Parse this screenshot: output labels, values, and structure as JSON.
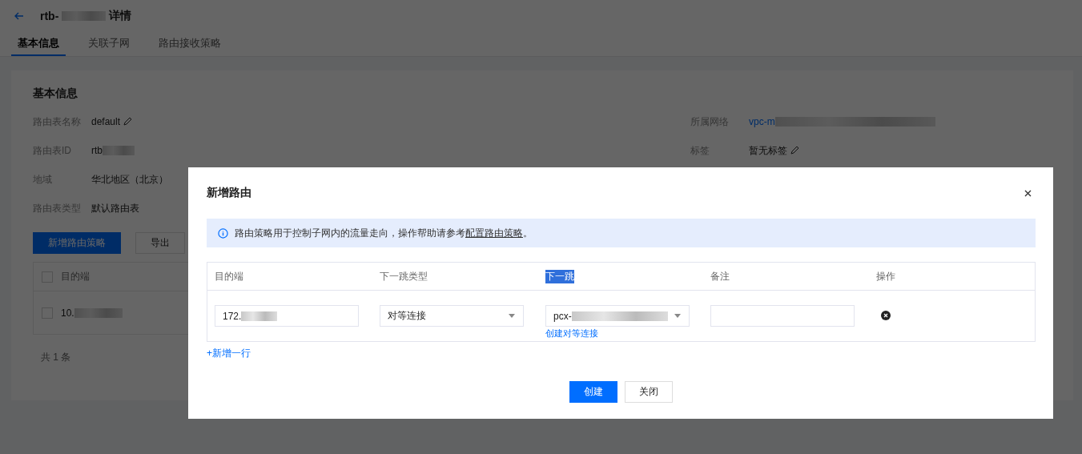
{
  "header": {
    "title_prefix": "rtb-",
    "title_redacted": true,
    "title_suffix": "详情"
  },
  "tabs": [
    {
      "label": "基本信息",
      "selected": true
    },
    {
      "label": "关联子网",
      "selected": false
    },
    {
      "label": "路由接收策略",
      "selected": false
    }
  ],
  "info": {
    "title": "基本信息",
    "left": [
      {
        "label": "路由表名称",
        "value": "default",
        "editable": true,
        "redacted": false,
        "link": false
      },
      {
        "label": "路由表ID",
        "value": "rtb",
        "editable": false,
        "redacted": true,
        "link": false
      },
      {
        "label": "地域",
        "value": "华北地区（北京）",
        "editable": false,
        "redacted": false,
        "link": false
      },
      {
        "label": "路由表类型",
        "value": "默认路由表",
        "editable": false,
        "redacted": false,
        "link": false
      }
    ],
    "right": [
      {
        "label": "所属网络",
        "value": "vpc-m",
        "editable": false,
        "redacted": true,
        "link": true
      },
      {
        "label": "标签",
        "value": "暂无标签",
        "editable": true,
        "redacted": false,
        "link": false
      }
    ]
  },
  "actions": [
    {
      "label": "新增路由策略",
      "kind": "primary"
    },
    {
      "label": "导出",
      "kind": "default"
    }
  ],
  "table": {
    "all_checked": false,
    "columns": [
      "目的端"
    ],
    "rows": [
      {
        "checked": false,
        "destination": "10.",
        "redacted": true
      }
    ],
    "footer": "共 1 条"
  },
  "dialog": {
    "title": "新增路由",
    "notice": {
      "text": "路由策略用于控制子网内的流量走向，操作帮助请参考",
      "link": "配置路由策略",
      "end": "。"
    },
    "columns": [
      {
        "label": "目的端",
        "highlighted": false
      },
      {
        "label": "下一跳类型",
        "highlighted": false
      },
      {
        "label": "下一跳",
        "highlighted": true
      },
      {
        "label": "备注",
        "highlighted": false
      },
      {
        "label": "操作",
        "highlighted": false
      }
    ],
    "rows": [
      {
        "destination": "172.",
        "destination_redacted": true,
        "next_hop_type": "对等连接",
        "next_hop": "pcx-",
        "next_hop_redacted": true,
        "next_hop_link": "创建对等连接"
      }
    ],
    "add_row": "+新增一行",
    "buttons": [
      {
        "label": "创建",
        "kind": "primary"
      },
      {
        "label": "关闭",
        "kind": "default"
      }
    ]
  }
}
